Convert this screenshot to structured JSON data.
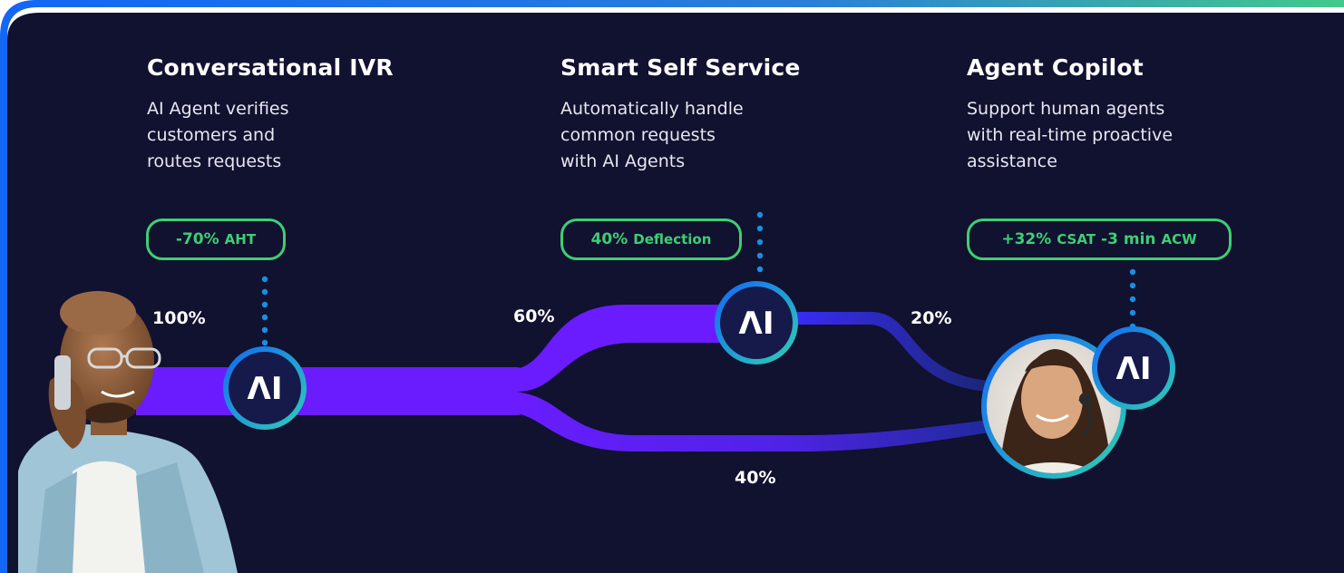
{
  "stages": [
    {
      "title": "Conversational IVR",
      "desc": [
        "AI Agent verifies",
        "customers and",
        "routes requests"
      ],
      "metric": [
        {
          "value": "-70%",
          "unit": "AHT"
        }
      ]
    },
    {
      "title": "Smart Self Service",
      "desc": [
        "Automatically handle",
        "common requests",
        "with AI Agents"
      ],
      "metric": [
        {
          "value": "40%",
          "unit": "Deflection"
        }
      ]
    },
    {
      "title": "Agent Copilot",
      "desc": [
        "Support human agents",
        "with real-time proactive",
        "assistance"
      ],
      "metric": [
        {
          "value": "+32%",
          "unit": "CSAT"
        },
        {
          "value": "-3 min",
          "unit": "ACW"
        }
      ]
    }
  ],
  "flow": {
    "entry_pct": "100%",
    "self_service_pct": "60%",
    "to_agent_pct": "20%",
    "direct_pct": "40%"
  },
  "ai_badge_label": "ΛI",
  "colors": {
    "background": "#111130",
    "flow_main": "#6a1cff",
    "flow_dark": "#2a22b0",
    "pill_green": "#3dcf73",
    "badge_ring": "#1a8fe0"
  }
}
